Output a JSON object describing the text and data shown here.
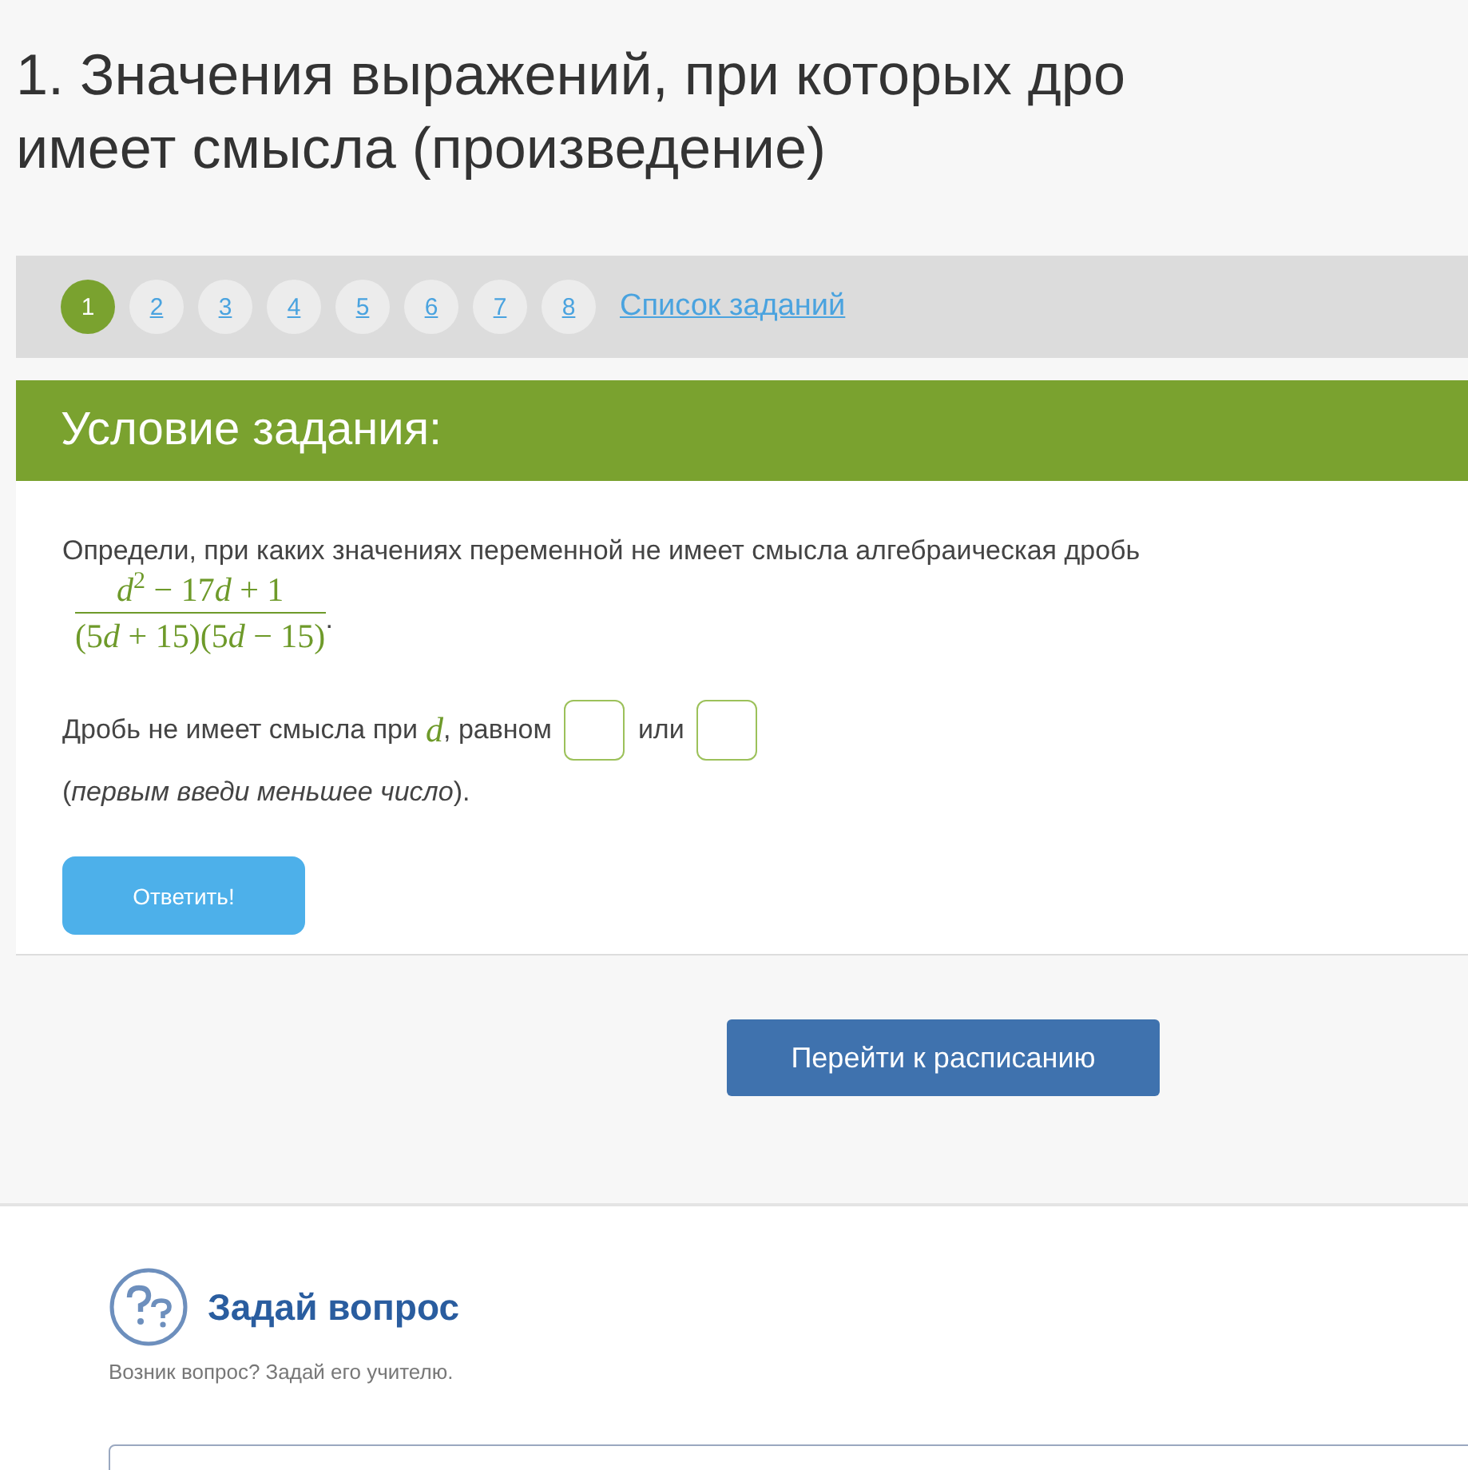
{
  "title_lines": [
    "1. Значения выражений, при которых дро",
    "имеет смысла (произведение)"
  ],
  "task_nav": {
    "items": [
      {
        "label": "1",
        "selected": true
      },
      {
        "label": "2",
        "selected": false
      },
      {
        "label": "3",
        "selected": false
      },
      {
        "label": "4",
        "selected": false
      },
      {
        "label": "5",
        "selected": false
      },
      {
        "label": "6",
        "selected": false
      },
      {
        "label": "7",
        "selected": false
      },
      {
        "label": "8",
        "selected": false
      }
    ],
    "list_link": "Список заданий"
  },
  "condition": {
    "header": "Условие задания:",
    "question": "Определи, при каких значениях переменной не имеет смысла алгебраическая дробь",
    "numerator": [
      {
        "kind": "var",
        "text": "d"
      },
      {
        "kind": "sup",
        "text": "2"
      },
      {
        "kind": "text",
        "text": " − 17"
      },
      {
        "kind": "var",
        "text": "d"
      },
      {
        "kind": "text",
        "text": " + 1"
      }
    ],
    "denominator": [
      {
        "kind": "text",
        "text": "(5"
      },
      {
        "kind": "var",
        "text": "d"
      },
      {
        "kind": "text",
        "text": " + 15)(5"
      },
      {
        "kind": "var",
        "text": "d"
      },
      {
        "kind": "text",
        "text": " − 15)"
      }
    ],
    "period": ".",
    "answer_prefix": "Дробь не имеет смысла при",
    "variable": "d",
    "answer_middle": ", равном",
    "answer_or": "или",
    "hint": "(*первым введи меньшее число*).",
    "submit": "Ответить!"
  },
  "schedule_button": "Перейти к расписанию",
  "ask": {
    "title": "Задай вопрос",
    "subtitle": "Возник вопрос? Задай его учителю."
  }
}
